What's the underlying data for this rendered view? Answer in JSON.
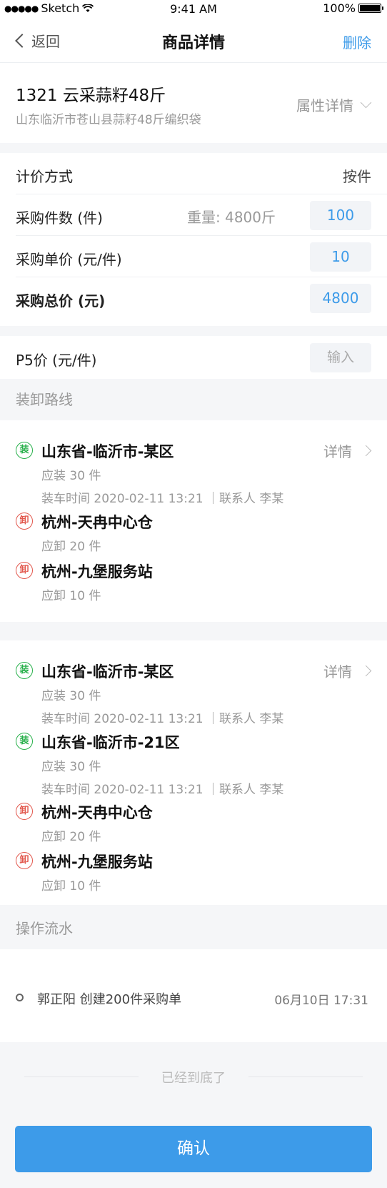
{
  "statusbar": {
    "carrier": "Sketch",
    "time": "9:41 AM",
    "battery": "100%"
  },
  "nav": {
    "back_label": "返回",
    "title": "商品详情",
    "delete_label": "删除"
  },
  "product": {
    "name": "1321 云采蒜籽48斤",
    "subtitle": "山东临沂市苍山县蒜籽48斤编织袋",
    "attr_label": "属性详情"
  },
  "pricing": {
    "method_label": "计价方式",
    "method_value": "按件",
    "count_label": "采购件数 (件)",
    "weight_text": "重量: 4800斤",
    "count_value": "100",
    "unit_price_label": "采购单价 (元/件)",
    "unit_price_value": "10",
    "total_label": "采购总价 (元)",
    "total_value": "4800"
  },
  "p5": {
    "label": "P5价 (元/件)",
    "placeholder": "输入"
  },
  "routes_title": "装卸路线",
  "detail_label": "详情",
  "badges": {
    "load": "装",
    "unload": "卸"
  },
  "route1": [
    {
      "type": "load",
      "name": "山东省-临沂市-某区",
      "qty": "应装 30 件",
      "meta": "装车时间 2020-02-11 13:21 ｜联系人 李某"
    },
    {
      "type": "unload",
      "name": "杭州-天冉中心仓",
      "qty": "应卸 20 件"
    },
    {
      "type": "unload",
      "name": "杭州-九堡服务站",
      "qty": "应卸 10 件"
    }
  ],
  "route2": [
    {
      "type": "load",
      "name": "山东省-临沂市-某区",
      "qty": "应装 30 件",
      "meta": "装车时间 2020-02-11 13:21 ｜联系人 李某"
    },
    {
      "type": "load",
      "name": "山东省-临沂市-21区",
      "qty": "应装 30 件",
      "meta": "装车时间 2020-02-11 13:21 ｜联系人 李某"
    },
    {
      "type": "unload",
      "name": "杭州-天冉中心仓",
      "qty": "应卸 20 件"
    },
    {
      "type": "unload",
      "name": "杭州-九堡服务站",
      "qty": "应卸 10 件"
    }
  ],
  "log_title": "操作流水",
  "log": [
    {
      "text": "郭正阳 创建200件采购单",
      "time": "06月10日 17:31"
    }
  ],
  "end_text": "已经到底了",
  "confirm_label": "确认"
}
